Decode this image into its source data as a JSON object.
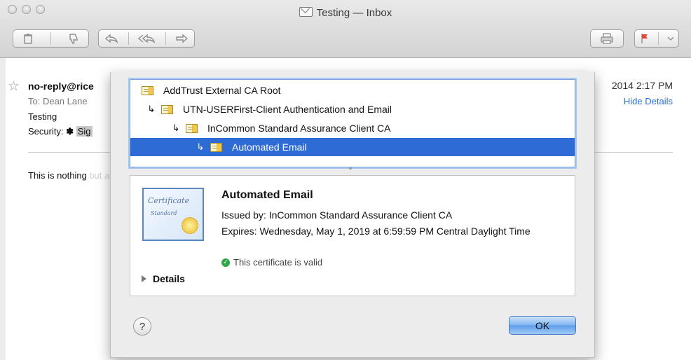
{
  "window": {
    "title": "Testing — Inbox"
  },
  "toolbar": {
    "buttons": [
      "delete",
      "junk",
      "reply",
      "reply-all",
      "forward",
      "print",
      "flag"
    ]
  },
  "message": {
    "from": "no-reply@rice",
    "to_line": "To:  Dean Lane",
    "subject": "Testing",
    "security_label": "Security:",
    "security_fragment": "Sig",
    "date": "2014  2:17 PM",
    "hide_details": "Hide Details",
    "body": "This is nothing",
    "body_dim": " but a test"
  },
  "cert_chain": [
    {
      "label": "AddTrust External CA Root",
      "level": 0,
      "selected": false
    },
    {
      "label": "UTN-USERFirst-Client Authentication and Email",
      "level": 1,
      "selected": false
    },
    {
      "label": "InCommon Standard Assurance Client CA",
      "level": 2,
      "selected": false
    },
    {
      "label": "Automated Email",
      "level": 3,
      "selected": true
    }
  ],
  "cert_detail": {
    "name": "Automated Email",
    "issued_by": "Issued by: InCommon Standard Assurance Client CA",
    "expires": "Expires: Wednesday, May 1, 2019 at 6:59:59 PM Central Daylight Time",
    "status": "This certificate is valid",
    "details_label": "Details",
    "image_text_1": "Certificate",
    "image_text_2": "Standard"
  },
  "dialog": {
    "help_label": "?",
    "ok_label": "OK"
  },
  "colors": {
    "selection": "#2f6bd5",
    "link": "#2b6fd9",
    "valid": "#2ea84a"
  }
}
